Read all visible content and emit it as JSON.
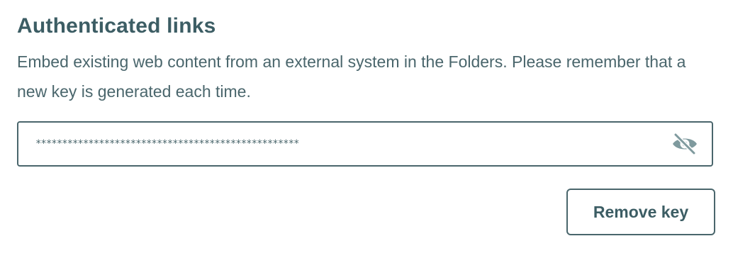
{
  "section": {
    "title": "Authenticated links",
    "description": "Embed existing web content from an external system in the Folders. Please remember that a new key is generated each time."
  },
  "key_field": {
    "masked_value": "**************************************************",
    "visibility_icon": "eye-slash-icon"
  },
  "actions": {
    "remove_label": "Remove key"
  },
  "colors": {
    "text": "#3f5f66",
    "border": "#4a666c",
    "icon": "#7f9a9e"
  }
}
